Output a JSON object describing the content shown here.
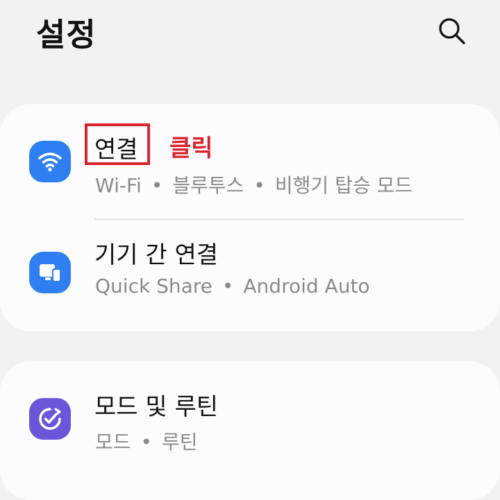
{
  "header": {
    "title": "설정",
    "search_icon": "search-icon"
  },
  "sections": [
    {
      "items": [
        {
          "title": "연결",
          "subtitle_parts": [
            "Wi-Fi",
            "블루투스",
            "비행기 탑승 모드"
          ],
          "icon": "wifi-icon",
          "icon_color": "#2f7ff2",
          "annotation": "클릭",
          "annotation_color": "#d8232a"
        },
        {
          "title": "기기 간 연결",
          "subtitle_parts": [
            "Quick Share",
            "Android Auto"
          ],
          "icon": "devices-icon",
          "icon_color": "#2f7ff2"
        }
      ]
    },
    {
      "items": [
        {
          "title": "모드 및 루틴",
          "subtitle_parts": [
            "모드",
            "루틴"
          ],
          "icon": "modes-routines-icon",
          "icon_color": "#6a56d8"
        }
      ]
    }
  ],
  "separator": "•"
}
